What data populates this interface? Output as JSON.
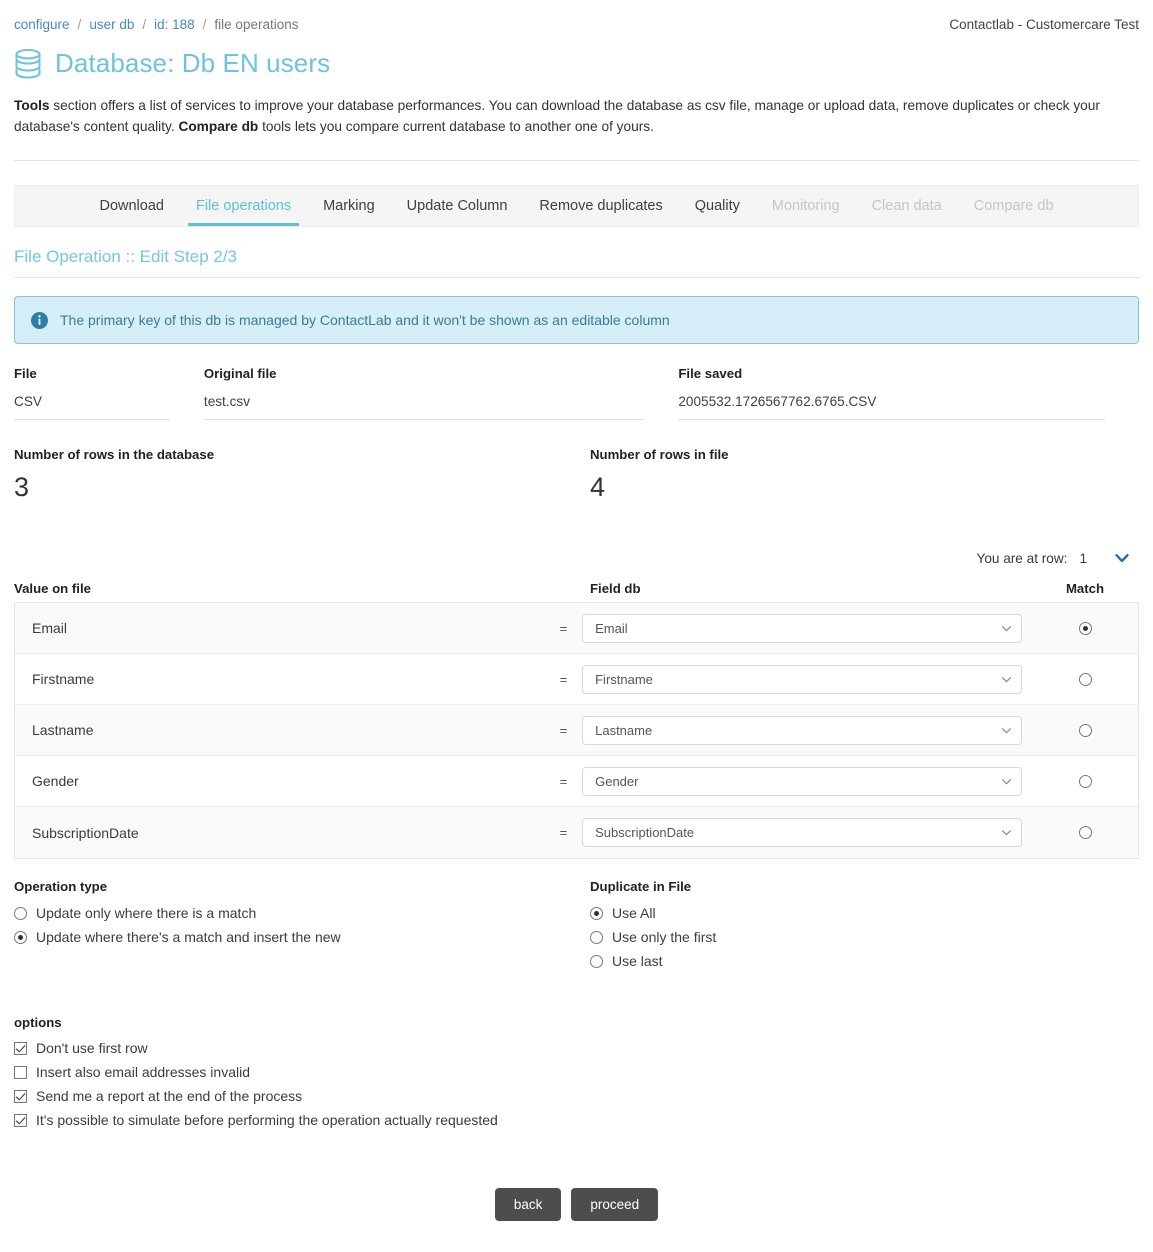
{
  "breadcrumb": {
    "items": [
      {
        "label": "configure",
        "type": "link"
      },
      {
        "label": "user db",
        "type": "link"
      },
      {
        "label": "id: 188",
        "type": "link"
      },
      {
        "label": "file operations",
        "type": "static"
      }
    ],
    "separator": "/"
  },
  "account": {
    "label": "Contactlab - Customercare Test"
  },
  "header": {
    "icon": "database-icon",
    "title": "Database: Db EN users"
  },
  "intro": {
    "bold_1": "Tools",
    "text_1": " section offers a list of services to improve your database performances. You can download the database as csv file, manage or upload data, remove duplicates or check your database's content quality. ",
    "bold_2": "Compare db",
    "text_2": " tools lets you compare current database to another one of yours."
  },
  "tabs": [
    {
      "label": "Download",
      "state": "normal"
    },
    {
      "label": "File operations",
      "state": "active"
    },
    {
      "label": "Marking",
      "state": "normal"
    },
    {
      "label": "Update Column",
      "state": "normal"
    },
    {
      "label": "Remove duplicates",
      "state": "normal"
    },
    {
      "label": "Quality",
      "state": "normal"
    },
    {
      "label": "Monitoring",
      "state": "disabled"
    },
    {
      "label": "Clean data",
      "state": "disabled"
    },
    {
      "label": "Compare db",
      "state": "disabled"
    }
  ],
  "section": {
    "subtitle": "File Operation :: Edit Step 2/3"
  },
  "alert": {
    "icon": "info-circle-icon",
    "message": "The primary key of this db is managed by ContactLab and it won't be shown as an editable column"
  },
  "file_info": [
    {
      "label": "File",
      "value": "CSV"
    },
    {
      "label": "Original file",
      "value": "test.csv"
    },
    {
      "label": "File saved",
      "value": "2005532.1726567762.6765.CSV"
    }
  ],
  "counts": [
    {
      "label": "Number of rows in the database",
      "value": "3"
    },
    {
      "label": "Number of rows in file",
      "value": "4"
    }
  ],
  "row_selector": {
    "label": "You are at row:",
    "value": "1",
    "icon": "chevron-down-icon"
  },
  "mapping": {
    "headers": {
      "value_on_file": "Value on file",
      "field_db": "Field db",
      "match": "Match",
      "equals": "="
    },
    "rows": [
      {
        "value": "Email",
        "field": "Email",
        "matched": true
      },
      {
        "value": "Firstname",
        "field": "Firstname",
        "matched": false
      },
      {
        "value": "Lastname",
        "field": "Lastname",
        "matched": false
      },
      {
        "value": "Gender",
        "field": "Gender",
        "matched": false
      },
      {
        "value": "SubscriptionDate",
        "field": "SubscriptionDate",
        "matched": false
      }
    ]
  },
  "operation_type": {
    "title": "Operation type",
    "options": [
      {
        "label": "Update only where there is a match",
        "selected": false
      },
      {
        "label": "Update where there's a match and insert the new",
        "selected": true
      }
    ]
  },
  "duplicate_in_file": {
    "title": "Duplicate in File",
    "options": [
      {
        "label": "Use All",
        "selected": true
      },
      {
        "label": "Use only the first",
        "selected": false
      },
      {
        "label": "Use last",
        "selected": false
      }
    ]
  },
  "options": {
    "title": "options",
    "items": [
      {
        "label": "Don't use first row",
        "checked": true
      },
      {
        "label": "Insert also email addresses invalid",
        "checked": false
      },
      {
        "label": "Send me a report at the end of the process",
        "checked": true
      },
      {
        "label": "It's possible to simulate before performing the operation actually requested",
        "checked": true
      }
    ]
  },
  "footer": {
    "back_label": "back",
    "proceed_label": "proceed"
  },
  "colors": {
    "accent_teal": "#5bc0de",
    "title_teal": "#6ec3dd",
    "link_blue": "#4a86c8",
    "alert_bg": "#d6eef7",
    "alert_border": "#7fc5dd",
    "alert_text": "#3a7c94",
    "button_dark": "#4d4d4d",
    "tabbar_bg": "#f5f5f5",
    "row_alt_bg": "#fafafa"
  }
}
